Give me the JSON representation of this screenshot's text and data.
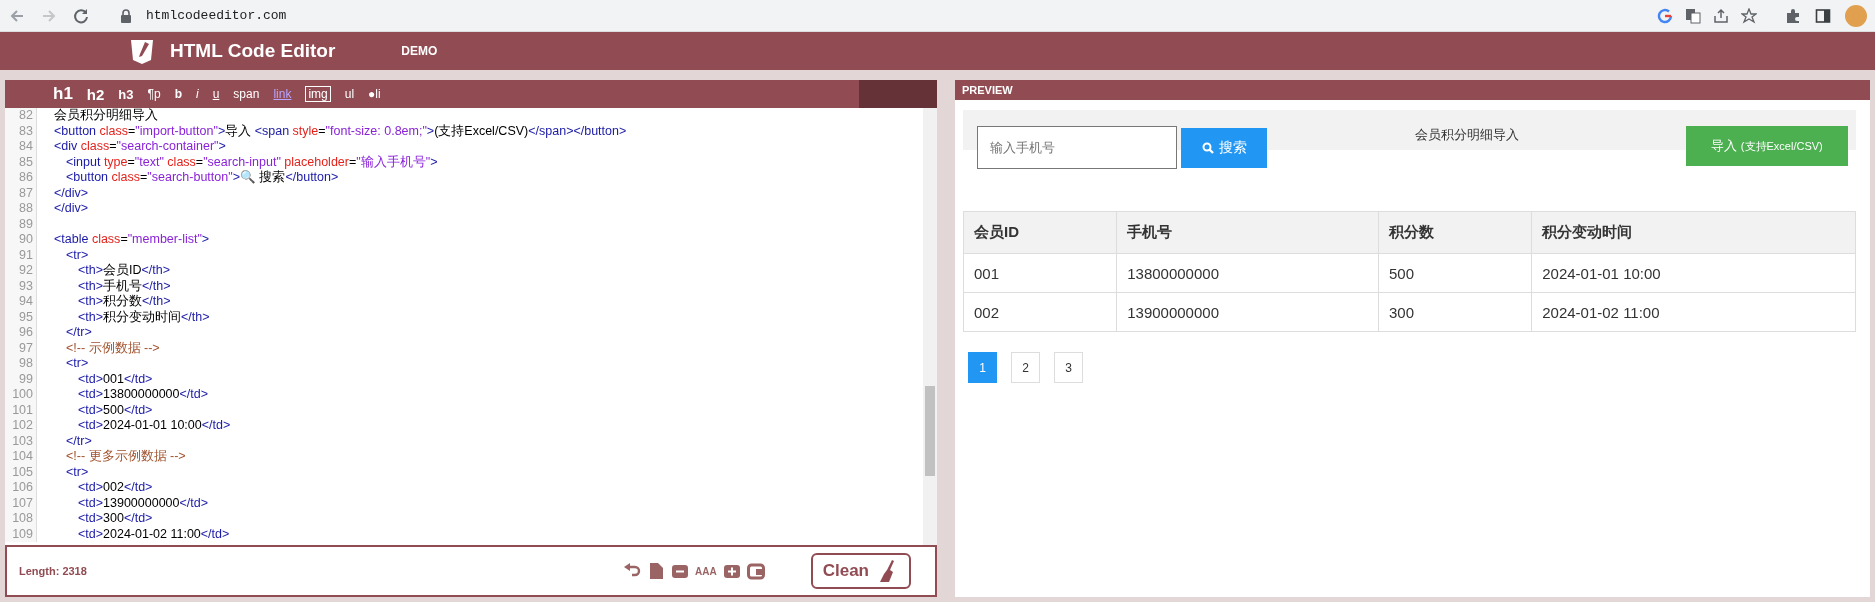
{
  "browser": {
    "url": "htmlcodeeditor.com"
  },
  "header": {
    "title": "HTML Code Editor",
    "menu": "DEMO"
  },
  "toolbar": [
    {
      "text": "h1",
      "kind": "h1"
    },
    {
      "text": "h2",
      "kind": "h2"
    },
    {
      "text": "h3",
      "kind": "h3"
    },
    {
      "text": "¶p",
      "kind": "plain"
    },
    {
      "text": "b",
      "kind": "bold"
    },
    {
      "text": "i",
      "kind": "italic"
    },
    {
      "text": "u",
      "kind": "underline"
    },
    {
      "text": "span",
      "kind": "plain"
    },
    {
      "text": "link",
      "kind": "link"
    },
    {
      "text": "img",
      "kind": "boxed"
    },
    {
      "text": "ul",
      "kind": "plain"
    },
    {
      "text": "●li",
      "kind": "plain"
    }
  ],
  "code": [
    {
      "children": [
        {
          "num": "82",
          "tokens": [
            {
              "kind": "text",
              "text": "会员积分明细导入"
            }
          ]
        },
        {
          "num": "83",
          "tokens": [
            {
              "kind": "tag",
              "text": "<button"
            },
            {
              "kind": "attr",
              "text": "class"
            },
            {
              "kind": "text",
              "text": "="
            },
            {
              "kind": "str",
              "text": "\"import-button\""
            },
            {
              "kind": "tag",
              "text": ">"
            },
            {
              "kind": "text",
              "text": "导入 "
            },
            {
              "kind": "tag",
              "text": "<span"
            },
            {
              "kind": "attr",
              "text": "style"
            },
            {
              "kind": "text",
              "text": "="
            },
            {
              "kind": "str",
              "text": "\"font-size: 0.8em;\""
            },
            {
              "kind": "tag",
              "text": ">"
            },
            {
              "kind": "text",
              "text": "(支持Excel/CSV)"
            },
            {
              "kind": "tag",
              "text": "</span></button>"
            }
          ]
        },
        {
          "num": "84",
          "tokens": [
            {
              "kind": "tag",
              "text": "<div"
            },
            {
              "kind": "attr",
              "text": "class"
            },
            {
              "kind": "text",
              "text": "="
            },
            {
              "kind": "str",
              "text": "\"search-container\""
            },
            {
              "kind": "tag",
              "text": ">"
            }
          ],
          "children": [
            {
              "num": "85",
              "tokens": [
                {
                  "kind": "tag",
                  "text": "<input"
                },
                {
                  "kind": "attr",
                  "text": "type"
                },
                {
                  "kind": "text",
                  "text": "="
                },
                {
                  "kind": "str",
                  "text": "\"text\""
                },
                {
                  "kind": "attr",
                  "text": "class"
                },
                {
                  "kind": "text",
                  "text": "="
                },
                {
                  "kind": "str",
                  "text": "\"search-input\""
                },
                {
                  "kind": "attr",
                  "text": "placeholder"
                },
                {
                  "kind": "text",
                  "text": "="
                },
                {
                  "kind": "str",
                  "text": "\"输入手机号\""
                },
                {
                  "kind": "tag",
                  "text": ">"
                }
              ]
            },
            {
              "num": "86",
              "tokens": [
                {
                  "kind": "tag",
                  "text": "<button"
                },
                {
                  "kind": "attr",
                  "text": "class"
                },
                {
                  "kind": "text",
                  "text": "="
                },
                {
                  "kind": "str",
                  "text": "\"search-button\""
                },
                {
                  "kind": "tag",
                  "text": ">"
                },
                {
                  "kind": "text",
                  "text": "🔍 搜索"
                },
                {
                  "kind": "tag",
                  "text": "</button>"
                }
              ]
            }
          ]
        },
        {
          "num": "87",
          "tokens": [
            {
              "kind": "tag",
              "text": "</div>"
            }
          ]
        }
      ]
    },
    {
      "num": "88",
      "tokens": [
        {
          "kind": "tag",
          "text": "</div>"
        }
      ]
    },
    {
      "num": "89"
    },
    {
      "num": "90",
      "tokens": [
        {
          "kind": "tag",
          "text": "<table"
        },
        {
          "kind": "attr",
          "text": "class"
        },
        {
          "kind": "text",
          "text": "="
        },
        {
          "kind": "str",
          "text": "\"member-list\""
        },
        {
          "kind": "tag",
          "text": ">"
        }
      ],
      "children": [
        {
          "num": "91",
          "tokens": [
            {
              "kind": "tag",
              "text": "<tr>"
            }
          ],
          "children": [
            {
              "num": "92",
              "tokens": [
                {
                  "kind": "tag",
                  "text": "<th>"
                },
                {
                  "kind": "text",
                  "text": "会员ID"
                },
                {
                  "kind": "tag",
                  "text": "</th>"
                }
              ]
            },
            {
              "num": "93",
              "tokens": [
                {
                  "kind": "tag",
                  "text": "<th>"
                },
                {
                  "kind": "text",
                  "text": "手机号"
                },
                {
                  "kind": "tag",
                  "text": "</th>"
                }
              ]
            },
            {
              "num": "94",
              "tokens": [
                {
                  "kind": "tag",
                  "text": "<th>"
                },
                {
                  "kind": "text",
                  "text": "积分数"
                },
                {
                  "kind": "tag",
                  "text": "</th>"
                }
              ]
            },
            {
              "num": "95",
              "tokens": [
                {
                  "kind": "tag",
                  "text": "<th>"
                },
                {
                  "kind": "text",
                  "text": "积分变动时间"
                },
                {
                  "kind": "tag",
                  "text": "</th>"
                }
              ]
            }
          ]
        },
        {
          "num": "96",
          "tokens": [
            {
              "kind": "tag",
              "text": "</tr>"
            }
          ]
        },
        {
          "num": "97",
          "tokens": [
            {
              "kind": "comment",
              "text": "<!-- 示例数据 -->"
            }
          ]
        },
        {
          "num": "98",
          "tokens": [
            {
              "kind": "tag",
              "text": "<tr>"
            }
          ],
          "children": [
            {
              "num": "99",
              "tokens": [
                {
                  "kind": "tag",
                  "text": "<td>"
                },
                {
                  "kind": "text",
                  "text": "001"
                },
                {
                  "kind": "tag",
                  "text": "</td>"
                }
              ]
            },
            {
              "num": "100",
              "tokens": [
                {
                  "kind": "tag",
                  "text": "<td>"
                },
                {
                  "kind": "text",
                  "text": "13800000000"
                },
                {
                  "kind": "tag",
                  "text": "</td>"
                }
              ]
            },
            {
              "num": "101",
              "tokens": [
                {
                  "kind": "tag",
                  "text": "<td>"
                },
                {
                  "kind": "text",
                  "text": "500"
                },
                {
                  "kind": "tag",
                  "text": "</td>"
                }
              ]
            },
            {
              "num": "102",
              "tokens": [
                {
                  "kind": "tag",
                  "text": "<td>"
                },
                {
                  "kind": "text",
                  "text": "2024-01-01 10:00"
                },
                {
                  "kind": "tag",
                  "text": "</td>"
                }
              ]
            }
          ]
        },
        {
          "num": "103",
          "tokens": [
            {
              "kind": "tag",
              "text": "</tr>"
            }
          ]
        },
        {
          "num": "104",
          "tokens": [
            {
              "kind": "comment",
              "text": "<!-- 更多示例数据 -->"
            }
          ]
        },
        {
          "num": "105",
          "tokens": [
            {
              "kind": "tag",
              "text": "<tr>"
            }
          ],
          "children": [
            {
              "num": "106",
              "tokens": [
                {
                  "kind": "tag",
                  "text": "<td>"
                },
                {
                  "kind": "text",
                  "text": "002"
                },
                {
                  "kind": "tag",
                  "text": "</td>"
                }
              ]
            },
            {
              "num": "107",
              "tokens": [
                {
                  "kind": "tag",
                  "text": "<td>"
                },
                {
                  "kind": "text",
                  "text": "13900000000"
                },
                {
                  "kind": "tag",
                  "text": "</td>"
                }
              ]
            },
            {
              "num": "108",
              "tokens": [
                {
                  "kind": "tag",
                  "text": "<td>"
                },
                {
                  "kind": "text",
                  "text": "300"
                },
                {
                  "kind": "tag",
                  "text": "</td>"
                }
              ]
            },
            {
              "num": "109",
              "tokens": [
                {
                  "kind": "tag",
                  "text": "<td>"
                },
                {
                  "kind": "text",
                  "text": "2024-01-02 11:00"
                },
                {
                  "kind": "tag",
                  "text": "</td>"
                }
              ]
            }
          ]
        }
      ]
    }
  ],
  "status": {
    "length": "Length: 2318",
    "font_size_label": "AAA",
    "clean_button": "Clean"
  },
  "preview": {
    "title": "PREVIEW",
    "search_placeholder": "输入手机号",
    "search_button": "搜索",
    "heading": "会员积分明细导入",
    "import_button": "导入",
    "import_note": "(支持Excel/CSV)",
    "table": {
      "columns": [
        "会员ID",
        "手机号",
        "积分数",
        "积分变动时间"
      ],
      "rows": [
        [
          "001",
          "13800000000",
          "500",
          "2024-01-01 10:00"
        ],
        [
          "002",
          "13900000000",
          "300",
          "2024-01-02 11:00"
        ]
      ]
    },
    "pages": [
      {
        "label": "1",
        "selected": true
      },
      {
        "label": "2",
        "selected": false
      },
      {
        "label": "3",
        "selected": false
      }
    ]
  }
}
